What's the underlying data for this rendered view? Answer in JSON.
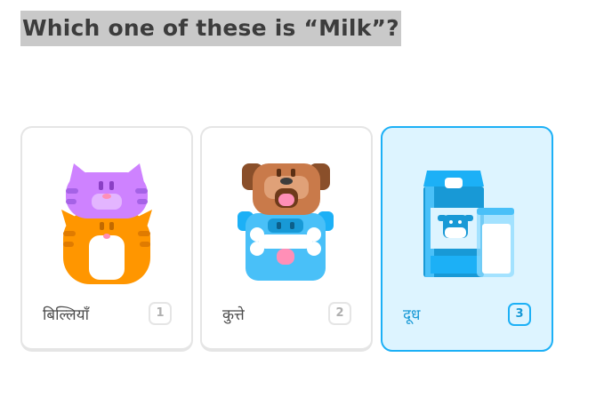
{
  "question": "Which one of these is “Milk”?",
  "options": [
    {
      "label": "बिल्लियाँ",
      "key": "1",
      "image": "cats-icon",
      "selected": false
    },
    {
      "label": "कुत्ते",
      "key": "2",
      "image": "dogs-icon",
      "selected": false
    },
    {
      "label": "दूध",
      "key": "3",
      "image": "milk-icon",
      "selected": true
    }
  ],
  "colors": {
    "selected_border": "#1cb0f6",
    "selected_background": "#ddf4ff",
    "card_border": "#e5e5e5",
    "text": "#4b4b4b"
  }
}
